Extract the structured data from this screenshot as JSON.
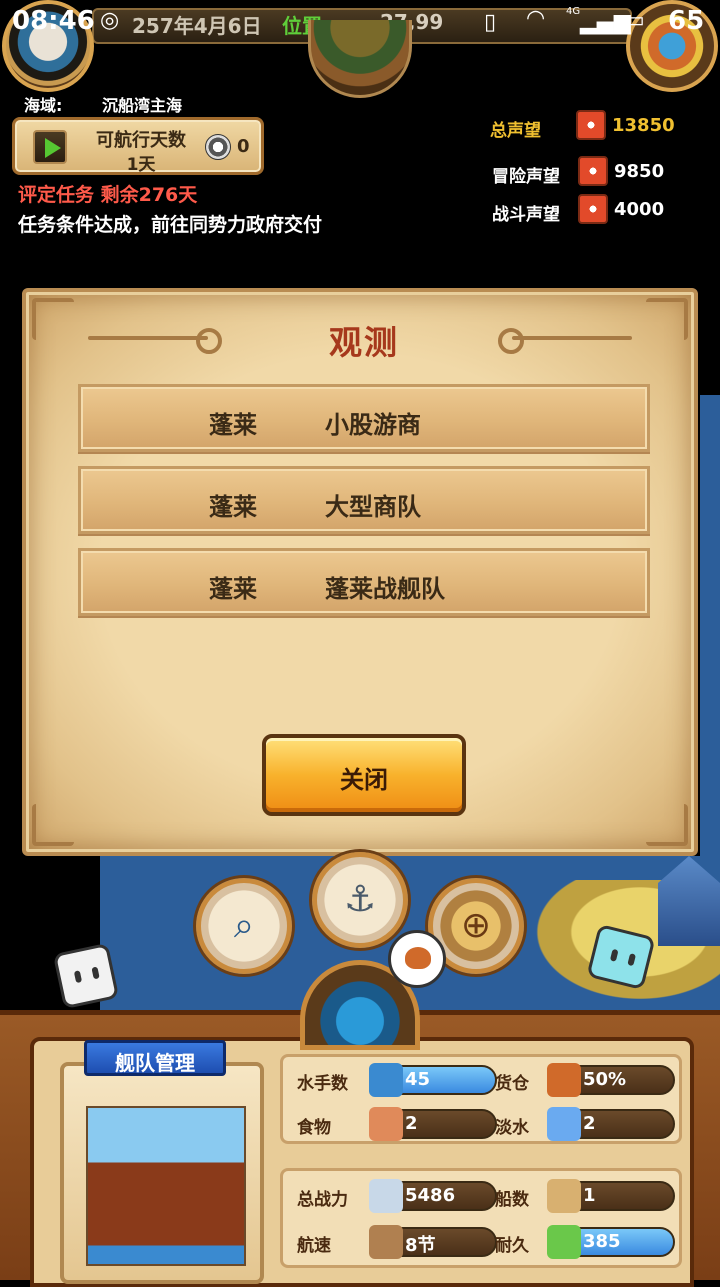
{
  "status_bar": {
    "time": "08:46",
    "network": "4G",
    "battery": "65"
  },
  "top_hud": {
    "date": "257年4月6日",
    "position_label": "位置:",
    "position_value": "27,99"
  },
  "sea_area": {
    "label": "海域:",
    "value": "沉船湾主海"
  },
  "sail_days": {
    "label": "可航行天数",
    "value": "1天",
    "coin_value": "0"
  },
  "mission": {
    "title": "评定任务  剩余276天",
    "description": "任务条件达成，前往同势力政府交付"
  },
  "reputation": {
    "total_label": "总声望",
    "total_value": "13850",
    "adventure_label": "冒险声望",
    "adventure_value": "9850",
    "battle_label": "战斗声望",
    "battle_value": "4000"
  },
  "dialog": {
    "title": "观测",
    "options": [
      {
        "place": "蓬莱",
        "fleet": "小股游商"
      },
      {
        "place": "蓬莱",
        "fleet": "大型商队"
      },
      {
        "place": "蓬莱",
        "fleet": "蓬莱战舰队"
      }
    ],
    "close_label": "关闭"
  },
  "fleet_panel": {
    "tag": "舰队管理",
    "stats": {
      "sailors_label": "水手数",
      "sailors_value": "45",
      "cargo_label": "货仓",
      "cargo_value": "50%",
      "food_label": "食物",
      "food_value": "2",
      "water_label": "淡水",
      "water_value": "2",
      "power_label": "总战力",
      "power_value": "5486",
      "ships_label": "船数",
      "ships_value": "1",
      "speed_label": "航速",
      "speed_value": "8节",
      "durability_label": "耐久",
      "durability_value": "385"
    }
  },
  "colors": {
    "accent_red": "#a6381c",
    "close_button": "#f8b22c",
    "stat_blue": "#3a8ae0"
  }
}
